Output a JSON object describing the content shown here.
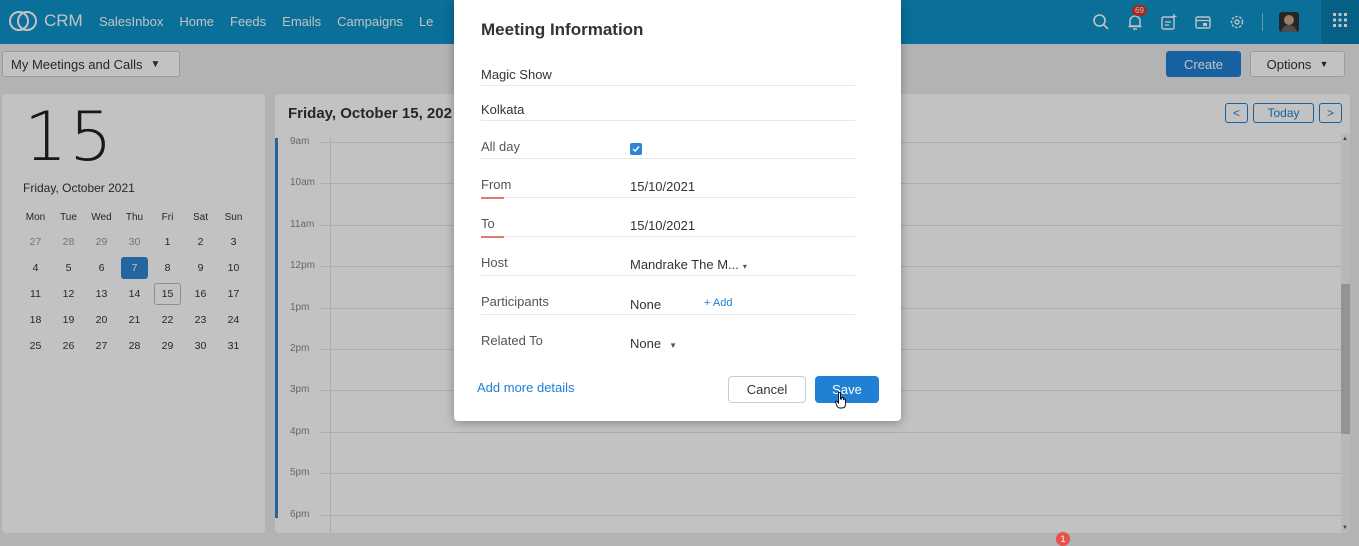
{
  "nav": {
    "brand": "CRM",
    "items": [
      "SalesInbox",
      "Home",
      "Feeds",
      "Emails",
      "Campaigns",
      "Le"
    ],
    "notification_count": "69"
  },
  "toolbar": {
    "view_label": "My Meetings and Calls",
    "create_label": "Create",
    "options_label": "Options"
  },
  "mini_calendar": {
    "big_day": "15",
    "caption": "Friday, October 2021",
    "weekdays": [
      "Mon",
      "Tue",
      "Wed",
      "Thu",
      "Fri",
      "Sat",
      "Sun"
    ],
    "weeks": [
      [
        "27",
        "28",
        "29",
        "30",
        "1",
        "2",
        "3"
      ],
      [
        "4",
        "5",
        "6",
        "7",
        "8",
        "9",
        "10"
      ],
      [
        "11",
        "12",
        "13",
        "14",
        "15",
        "16",
        "17"
      ],
      [
        "18",
        "19",
        "20",
        "21",
        "22",
        "23",
        "24"
      ],
      [
        "25",
        "26",
        "27",
        "28",
        "29",
        "30",
        "31"
      ]
    ],
    "selected_day": "7",
    "today_day": "15"
  },
  "day_view": {
    "title": "Friday, October 15, 202",
    "today_label": "Today",
    "prev_symbol": "<",
    "next_symbol": ">",
    "hours": [
      "9am",
      "10am",
      "11am",
      "12pm",
      "1pm",
      "2pm",
      "3pm",
      "4pm",
      "5pm",
      "6pm"
    ]
  },
  "modal": {
    "title": "Meeting Information",
    "meeting_title": "Magic Show",
    "location": "Kolkata",
    "all_day_label": "All day",
    "all_day_checked": true,
    "from_label": "From",
    "from_value": "15/10/2021",
    "to_label": "To",
    "to_value": "15/10/2021",
    "host_label": "Host",
    "host_value": "Mandrake The M...",
    "participants_label": "Participants",
    "participants_value": "None",
    "add_label": "+ Add",
    "related_label": "Related To",
    "related_value": "None",
    "more_details_label": "Add more details",
    "cancel_label": "Cancel",
    "save_label": "Save"
  },
  "bottom_badge": "1",
  "colors": {
    "topbar": "#0e93c9",
    "primary": "#1f80d4",
    "required": "#e07a6e"
  }
}
